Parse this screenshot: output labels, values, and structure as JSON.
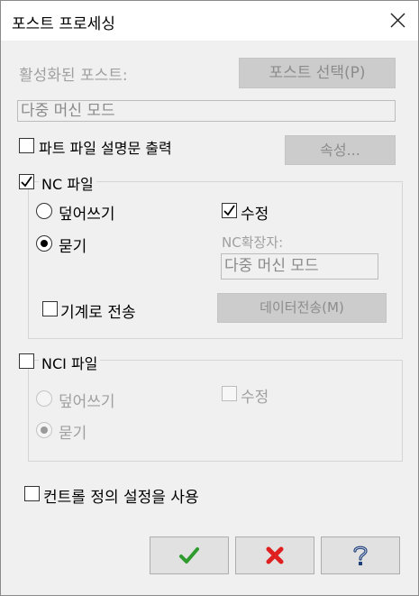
{
  "window": {
    "title": "포스트 프로세싱"
  },
  "post": {
    "active_label": "활성화된 포스트:",
    "select_button": "포스트 선택(P)",
    "active_value": "다중 머신 모드"
  },
  "part_desc": {
    "label": "파트 파일 설명문 출력",
    "checked": false,
    "props_button": "속성..."
  },
  "nc": {
    "group_label": "NC 파일",
    "checked": true,
    "overwrite_label": "덮어쓰기",
    "ask_label": "묻기",
    "selected": "ask",
    "edit_label": "수정",
    "edit_checked": true,
    "ext_label": "NC확장자:",
    "ext_value": "다중 머신 모드",
    "send_label": "기계로 전송",
    "send_checked": false,
    "transfer_button": "데이터전송(M)"
  },
  "nci": {
    "group_label": "NCI 파일",
    "checked": false,
    "overwrite_label": "덮어쓰기",
    "ask_label": "묻기",
    "selected": "ask",
    "edit_label": "수정",
    "edit_checked": false
  },
  "control_def": {
    "label": "컨트롤 정의 설정을 사용",
    "checked": false
  },
  "footer": {
    "ok_icon": "green-check-icon",
    "cancel_icon": "red-x-icon",
    "help_icon": "question-mark-icon"
  },
  "colors": {
    "ok": "#2e9b2e",
    "cancel": "#e02020",
    "help_navy": "#1f3f7a",
    "disabled_text": "#a0a0a0"
  }
}
